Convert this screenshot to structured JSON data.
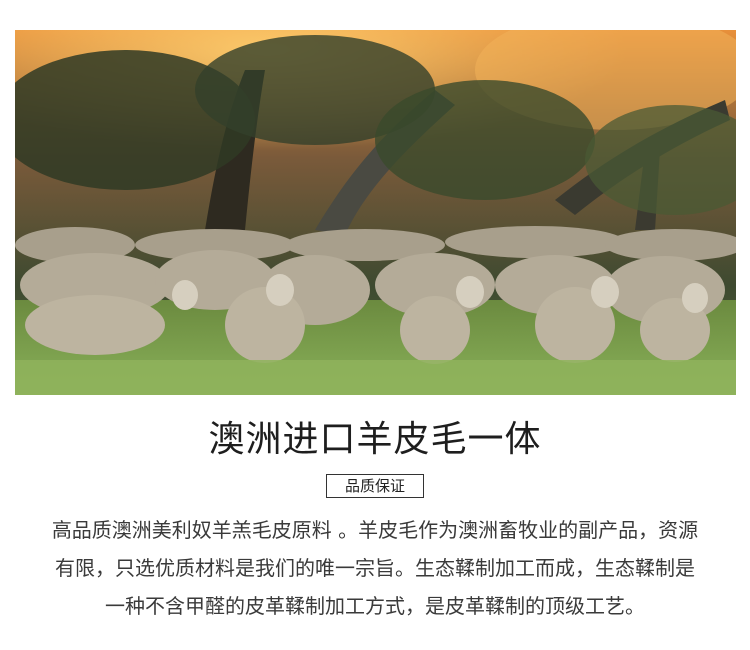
{
  "hero": {
    "image": "merino-sheep-flock-photo",
    "alt": "澳洲美利奴羊群"
  },
  "title": "澳洲进口羊皮毛一体",
  "badge": "品质保证",
  "description": "高品质澳洲美利奴羊羔毛皮原料 。羊皮毛作为澳洲畜牧业的副产品，资源有限，只选优质材料是我们的唯一宗旨。生态鞣制加工而成，生态鞣制是一种不含甲醛的皮革鞣制加工方式，是皮革鞣制的顶级工艺。",
  "colors": {
    "sky": "#f0a040",
    "grass": "#7a9a45",
    "wool": "#b4ab98"
  }
}
